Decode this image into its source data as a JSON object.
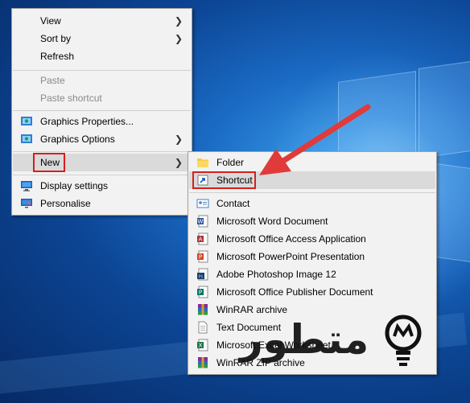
{
  "context_menu": {
    "items": [
      {
        "label": "View",
        "submenu": true
      },
      {
        "label": "Sort by",
        "submenu": true
      },
      {
        "label": "Refresh"
      },
      {
        "label": "Paste",
        "disabled": true
      },
      {
        "label": "Paste shortcut",
        "disabled": true
      },
      {
        "label": "Graphics Properties...",
        "icon": "graphics-icon"
      },
      {
        "label": "Graphics Options",
        "icon": "graphics-icon",
        "submenu": true
      },
      {
        "label": "New",
        "submenu": true,
        "highlighted": true
      },
      {
        "label": "Display settings",
        "icon": "display-icon"
      },
      {
        "label": "Personalise",
        "icon": "personalise-icon"
      }
    ]
  },
  "new_submenu": {
    "items": [
      {
        "label": "Folder",
        "icon": "folder-icon"
      },
      {
        "label": "Shortcut",
        "icon": "shortcut-icon",
        "highlighted": true
      },
      {
        "label": "Contact",
        "icon": "contact-icon"
      },
      {
        "label": "Microsoft Word Document",
        "icon": "word-icon"
      },
      {
        "label": "Microsoft Office Access Application",
        "icon": "access-icon"
      },
      {
        "label": "Microsoft PowerPoint Presentation",
        "icon": "powerpoint-icon"
      },
      {
        "label": "Adobe Photoshop Image 12",
        "icon": "photoshop-icon"
      },
      {
        "label": "Microsoft Office Publisher Document",
        "icon": "publisher-icon"
      },
      {
        "label": "WinRAR archive",
        "icon": "winrar-icon"
      },
      {
        "label": "Text Document",
        "icon": "text-document-icon"
      },
      {
        "label": "Microsoft Excel Worksheet",
        "icon": "excel-icon"
      },
      {
        "label": "WinRAR ZIP archive",
        "icon": "winrar-zip-icon"
      }
    ]
  },
  "watermark": {
    "text": "متطور"
  },
  "colors": {
    "annotation_red": "#d41f1f",
    "arrow_red": "#e03a3a",
    "menu_bg": "#f2f2f2",
    "highlight": "#dadada"
  }
}
